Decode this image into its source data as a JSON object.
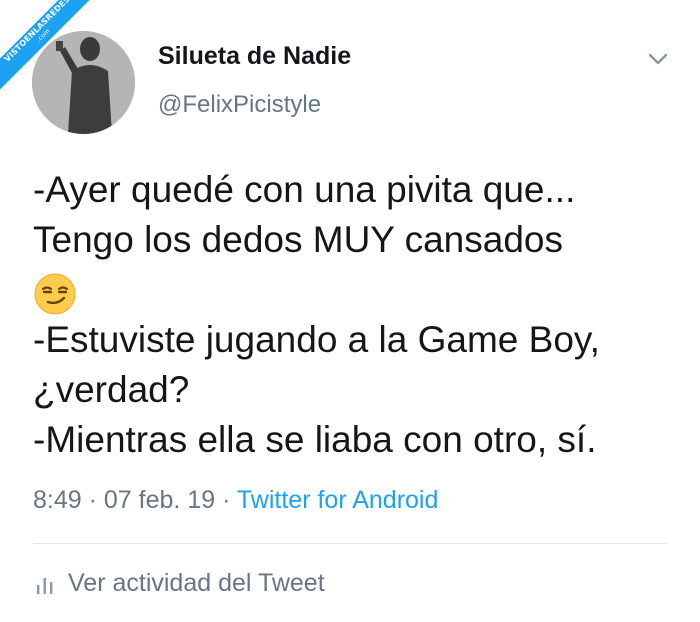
{
  "watermark": {
    "text": "VISTOENLASREDES",
    "sub": ".com",
    "color": "#1da1f2"
  },
  "author": {
    "name": "Silueta de Nadie",
    "handle": "@FelixPicistyle"
  },
  "icons": {
    "menu": "chevron-down-icon",
    "emoji": "smirking-face-emoji",
    "activity": "bar-chart-icon"
  },
  "tweet": {
    "line1": "-Ayer quedé con una pivita que...",
    "line2": "Tengo los dedos MUY cansados",
    "emoji": "😏",
    "line3": "-Estuviste jugando a la Game Boy,",
    "line4": "¿verdad?",
    "line5": "-Mientras ella se liaba con otro, sí."
  },
  "meta": {
    "time": "8:49",
    "date": "07 feb. 19",
    "separator": "·",
    "source": "Twitter for Android"
  },
  "footer": {
    "activity_label": "Ver actividad del Tweet"
  },
  "colors": {
    "text": "#14171a",
    "secondary": "#657786",
    "link": "#1da1f2",
    "divider": "#e1e8ed"
  }
}
